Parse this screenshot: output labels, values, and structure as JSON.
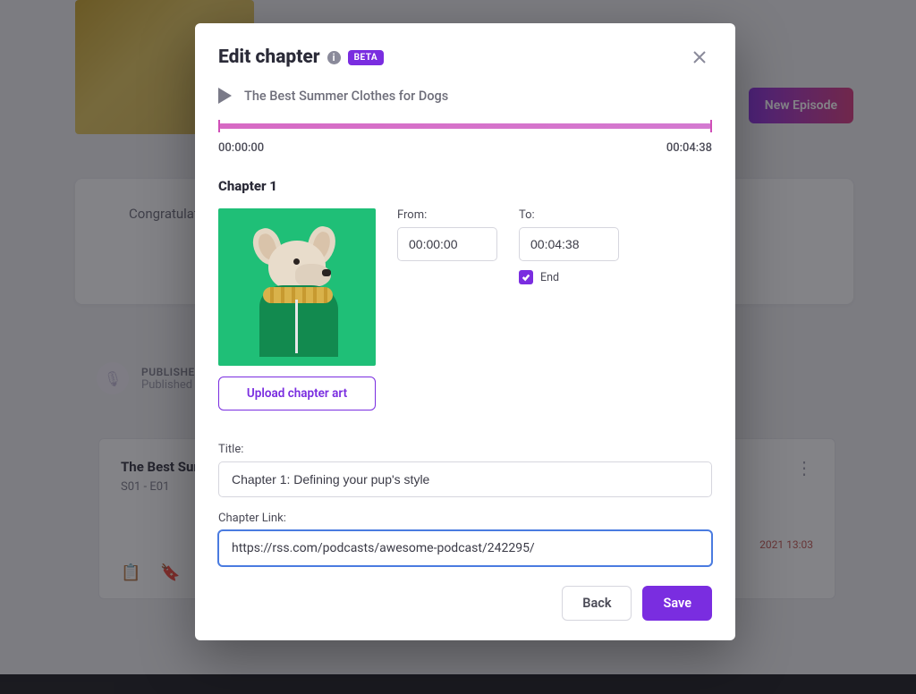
{
  "background": {
    "new_episode_btn": "New Episode",
    "congrats_text": "Congratulations…  easy, and",
    "publish_heading": "PUBLISHED",
    "publish_sub": "Published",
    "episode_card": {
      "title": "The Best Summer…",
      "sub": "S01 - E01",
      "date": "2021 13:03"
    }
  },
  "modal": {
    "title": "Edit chapter",
    "beta_badge": "BETA",
    "episode_title": "The Best Summer Clothes for Dogs",
    "time_start": "00:00:00",
    "time_end": "00:04:38",
    "chapter_heading": "Chapter 1",
    "upload_btn": "Upload chapter art",
    "from_label": "From:",
    "from_value": "00:00:00",
    "to_label": "To:",
    "to_value": "00:04:38",
    "end_label": "End",
    "end_checked": true,
    "title_label": "Title:",
    "title_value": "Chapter 1: Defining your pup's style",
    "link_label": "Chapter Link:",
    "link_value": "https://rss.com/podcasts/awesome-podcast/242295/",
    "back_btn": "Back",
    "save_btn": "Save"
  }
}
